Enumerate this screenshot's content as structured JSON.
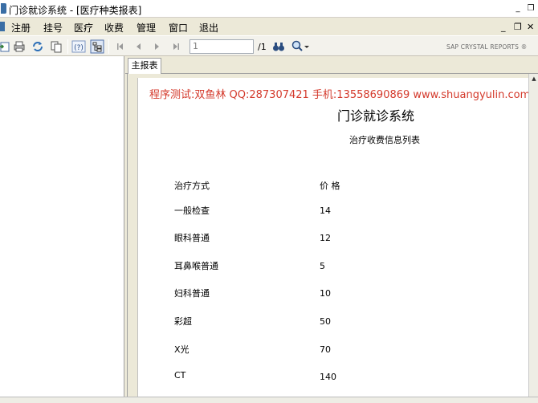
{
  "window": {
    "title": "门诊就诊系统 - [医疗种类报表]",
    "minimize": "_",
    "restore": "❐",
    "close": "✕"
  },
  "menu": {
    "items": [
      {
        "label": "注册"
      },
      {
        "label": "挂号"
      },
      {
        "label": "医疗"
      },
      {
        "label": "收费"
      },
      {
        "label": "管理"
      },
      {
        "label": "窗口"
      },
      {
        "label": "退出"
      }
    ],
    "mdi_minimize": "_",
    "mdi_restore": "❐",
    "mdi_close": "✕"
  },
  "toolbar": {
    "page_value": "1",
    "page_total": "/1",
    "brand": "SAP CRYSTAL REPORTS ®"
  },
  "tabs": [
    {
      "label": "主报表"
    }
  ],
  "report": {
    "watermark": "程序测试:双鱼林 QQ:287307421 手机:13558690869 www.shuangyulin.com",
    "title": "门诊就诊系统",
    "subtitle": "治疗收费信息列表",
    "columns": [
      "治疗方式",
      "价 格"
    ],
    "rows": [
      {
        "name": "一般检查",
        "price": "14"
      },
      {
        "name": "眼科普通",
        "price": "12"
      },
      {
        "name": "耳鼻喉普通",
        "price": "5"
      },
      {
        "name": "妇科普通",
        "price": "10"
      },
      {
        "name": "彩超",
        "price": "50"
      },
      {
        "name": "X光",
        "price": "70"
      },
      {
        "name": "CT",
        "price": "140"
      }
    ]
  },
  "colors": {
    "watermark": "#d43a2c",
    "accent": "#3a6ea5"
  }
}
